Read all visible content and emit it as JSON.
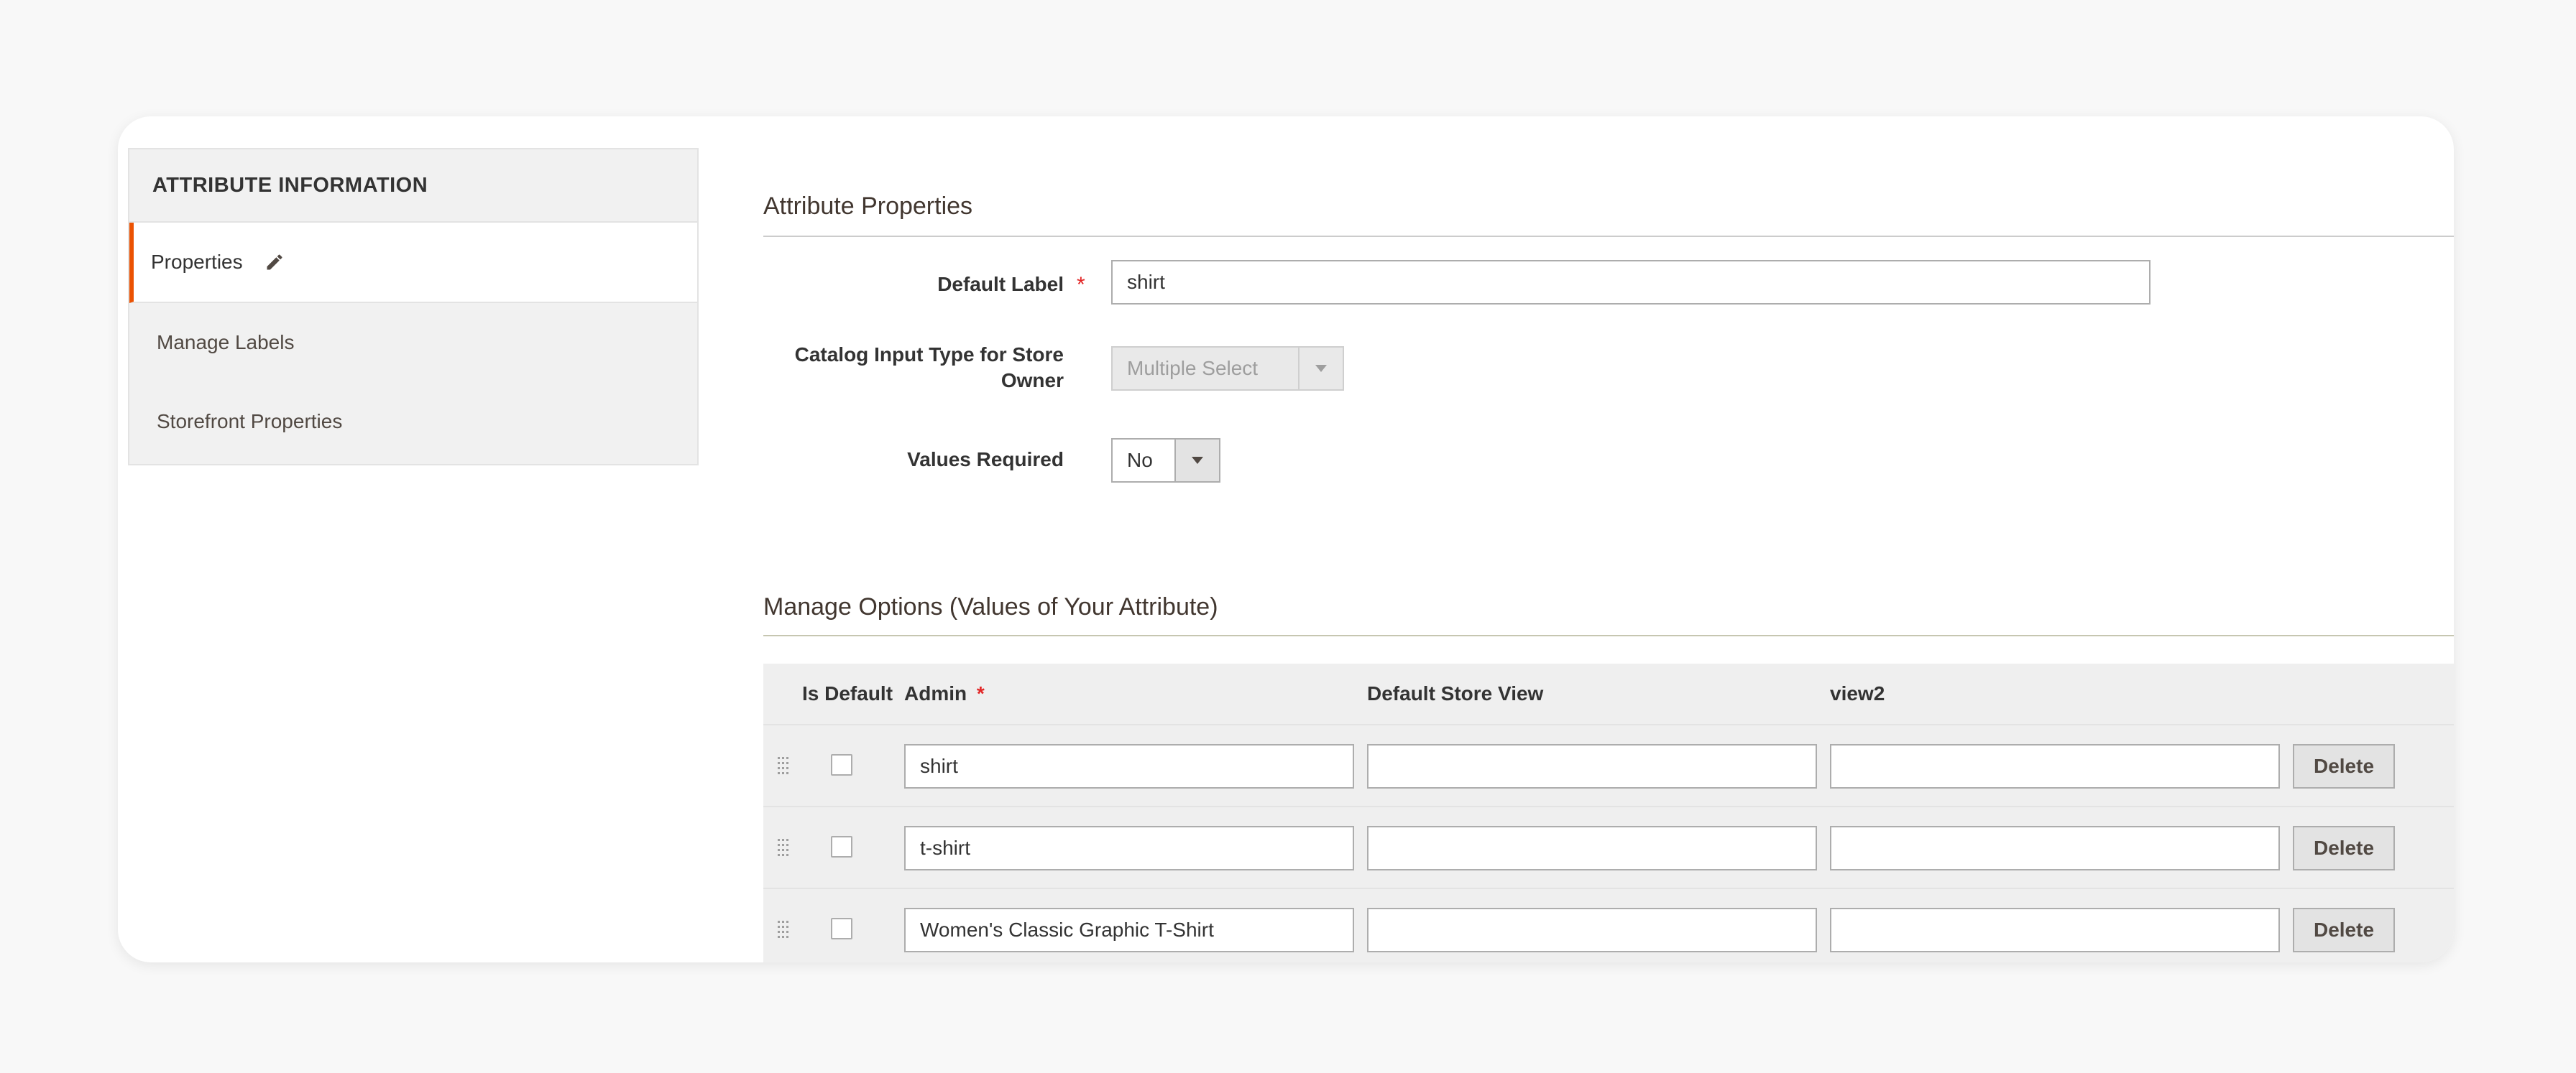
{
  "sidebar": {
    "title": "ATTRIBUTE INFORMATION",
    "items": [
      {
        "label": "Properties",
        "active": true,
        "icon": "pencil-icon"
      },
      {
        "label": "Manage Labels"
      },
      {
        "label": "Storefront Properties"
      }
    ]
  },
  "attribute_properties": {
    "title": "Attribute Properties",
    "default_label": {
      "label": "Default Label",
      "required_mark": "*",
      "value": "shirt"
    },
    "catalog_input": {
      "label_line1": "Catalog Input Type for Store",
      "label_line2": "Owner",
      "value": "Multiple Select"
    },
    "values_required": {
      "label": "Values Required",
      "value": "No"
    }
  },
  "manage_options": {
    "title": "Manage Options (Values of Your Attribute)",
    "columns": {
      "is_default": "Is Default",
      "admin": "Admin",
      "admin_required": "*",
      "default_store_view": "Default Store View",
      "view2": "view2"
    },
    "rows": [
      {
        "admin": "shirt",
        "default_store_view": "",
        "view2": "",
        "delete_label": "Delete"
      },
      {
        "admin": "t-shirt",
        "default_store_view": "",
        "view2": "",
        "delete_label": "Delete"
      },
      {
        "admin": "Women's Classic Graphic T-Shirt",
        "default_store_view": "",
        "view2": "",
        "delete_label": "Delete"
      }
    ]
  },
  "colors": {
    "accent": "#eb5202",
    "required": "#e22626"
  }
}
